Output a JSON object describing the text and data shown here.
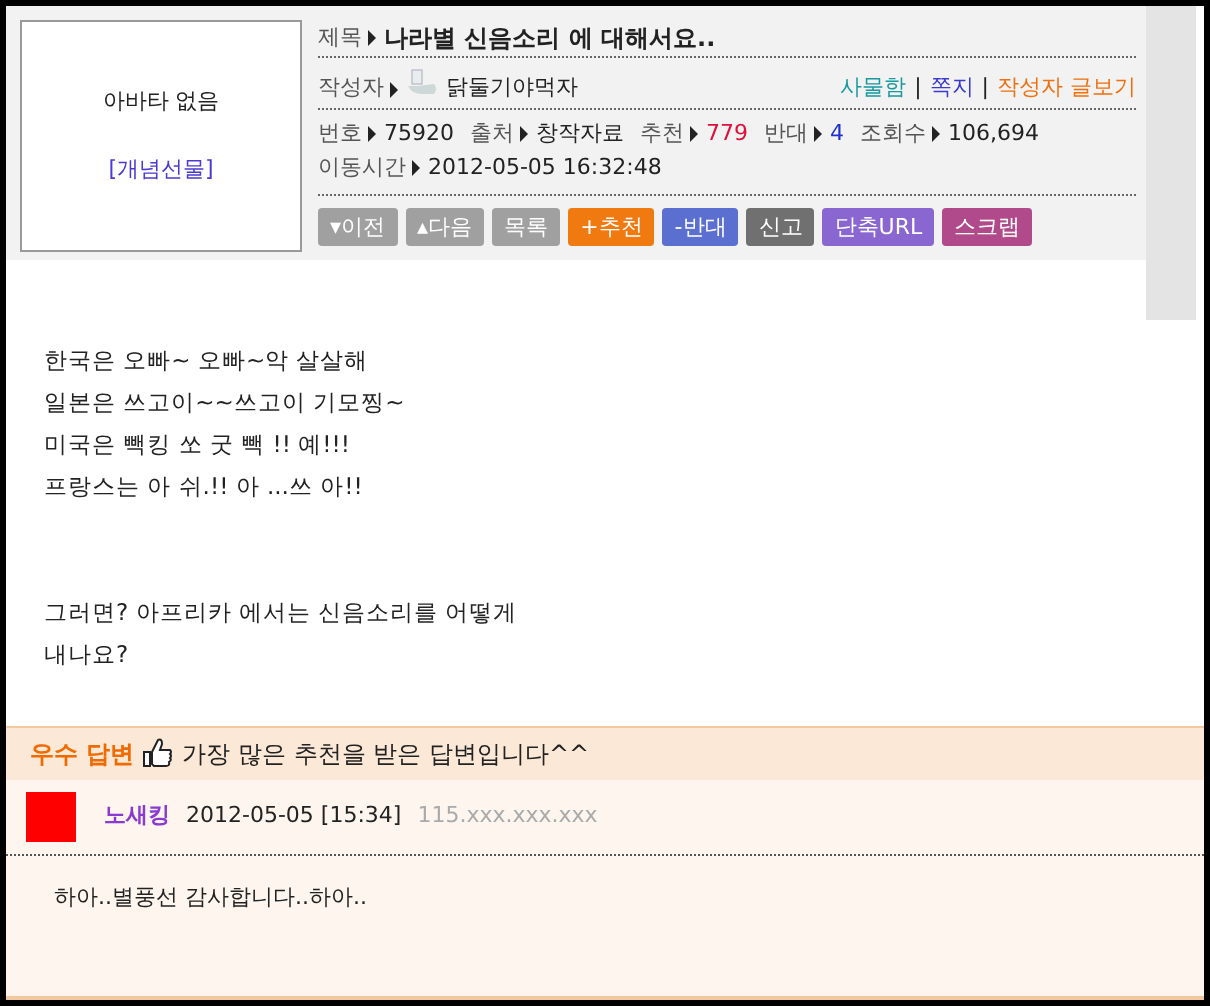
{
  "avatar": {
    "text": "아바타 없음",
    "link": "[개념선물]"
  },
  "title": {
    "label": "제목",
    "text": "나라별 신음소리 에 대해서요.."
  },
  "author": {
    "label": "작성자",
    "name": "닭둘기야먹자",
    "separator": "|",
    "links": [
      {
        "text": "사물함",
        "color": "#1a9aa0"
      },
      {
        "text": "쪽지",
        "color": "#3a3ad0"
      },
      {
        "text": "작성자 글보기",
        "color": "#f07010"
      }
    ]
  },
  "meta": [
    {
      "label": "번호",
      "value": "75920",
      "color": "#222222"
    },
    {
      "label": "출처",
      "value": "창작자료",
      "color": "#222222"
    },
    {
      "label": "추천",
      "value": "779",
      "color": "#e0103a"
    },
    {
      "label": "반대",
      "value": "4",
      "color": "#2030d0"
    },
    {
      "label": "조회수",
      "value": "106,694",
      "color": "#222222"
    }
  ],
  "moved": {
    "label": "이동시간",
    "value": "2012-05-05 16:32:48"
  },
  "buttons": [
    {
      "label": "▾이전",
      "color": "#a0a0a0"
    },
    {
      "label": "▴다음",
      "color": "#a0a0a0"
    },
    {
      "label": "목록",
      "color": "#a0a0a0"
    },
    {
      "label": "+추천",
      "color": "#f07a10"
    },
    {
      "label": "-반대",
      "color": "#5a6fd0"
    },
    {
      "label": "신고",
      "color": "#707070"
    },
    {
      "label": "단축URL",
      "color": "#8a66d0"
    },
    {
      "label": "스크랩",
      "color": "#b04a8a"
    }
  ],
  "body": [
    [
      "한국은 오빠~ 오빠~악 살살해",
      "일본은 쓰고이~~쓰고이 기모찡~",
      "미국은 빽킹 쏘 굿 빽 !! 예!!!",
      "프랑스는 아 쉬.!! 아 ...쓰 아!!"
    ],
    [
      "그러면? 아프리카 에서는 신음소리를 어떻게",
      "내나요?"
    ]
  ],
  "best_answer": {
    "badge": "우수 답변",
    "text": "가장 많은 추천을 받은 답변입니다^^"
  },
  "comment": {
    "color": "#ff0000",
    "name": "노새킹",
    "date": "2012-05-05 [15:34]",
    "ip": "115.xxx.xxx.xxx",
    "text": "하아..별풍선 감사합니다..하아.."
  }
}
